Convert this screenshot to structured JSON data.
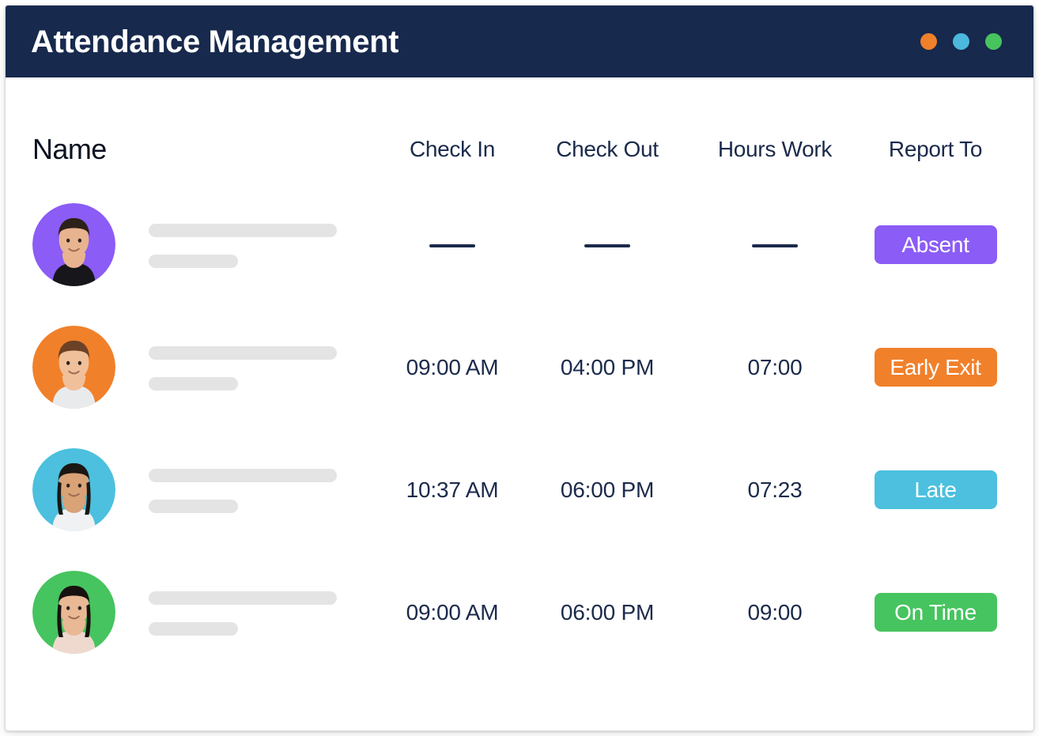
{
  "window": {
    "title": "Attendance Management",
    "titlebar_bg": "#17294d",
    "controls": [
      {
        "name": "orange",
        "color": "#f0802a"
      },
      {
        "name": "blue",
        "color": "#4cb8dd"
      },
      {
        "name": "green",
        "color": "#47c45e"
      }
    ]
  },
  "table": {
    "headers": {
      "name": "Name",
      "check_in": "Check In",
      "check_out": "Check Out",
      "hours_work": "Hours Work",
      "report_to": "Report To"
    },
    "rows": [
      {
        "avatar_color": "#8b5cf6",
        "check_in": "—",
        "check_out": "—",
        "hours_work": "—",
        "status": "Absent",
        "status_color": "#8b5cf6",
        "empty": true
      },
      {
        "avatar_color": "#f1802a",
        "check_in": "09:00 AM",
        "check_out": "04:00 PM",
        "hours_work": "07:00",
        "status": "Early Exit",
        "status_color": "#f1802a",
        "empty": false
      },
      {
        "avatar_color": "#4cc0de",
        "check_in": "10:37 AM",
        "check_out": "06:00 PM",
        "hours_work": "07:23",
        "status": "Late",
        "status_color": "#4cc0de",
        "empty": false
      },
      {
        "avatar_color": "#46c45f",
        "check_in": "09:00 AM",
        "check_out": "06:00 PM",
        "hours_work": "09:00",
        "status": "On Time",
        "status_color": "#46c45f",
        "empty": false
      }
    ]
  }
}
